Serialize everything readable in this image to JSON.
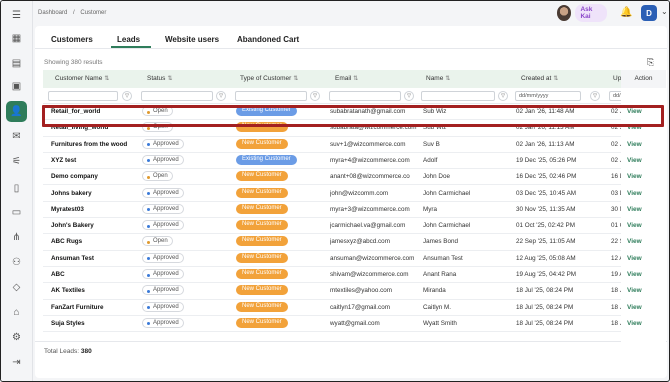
{
  "topbar": {
    "breadcrumb": [
      "Dashboard",
      "/",
      "Customer"
    ],
    "ask_kai_label": "Ask Kai",
    "user_initial": "D"
  },
  "tabs": [
    "Customers",
    "Leads",
    "Website users",
    "Abandoned Cart"
  ],
  "active_tab": "Leads",
  "showing_text": "Showing 380 results",
  "table": {
    "columns": [
      "Customer Name",
      "Status",
      "Type of Customer",
      "Email",
      "Name",
      "Created at",
      "Up"
    ],
    "date_placeholder": "dd/mm/yyyy",
    "date_placeholder_2": "dd/",
    "rows": [
      {
        "customer": "Retail_for_world",
        "status": "Open",
        "type": "Existing Customer",
        "email": "subabratanath@gmail.com",
        "name": "Sub Wiz",
        "created": "02 Jan '26, 11:48 AM",
        "up": "02 J"
      },
      {
        "customer": "Retail_living_world",
        "status": "Open",
        "type": "New Customer",
        "email": "subabrata@wizcommerce.com",
        "name": "Sub Wiz",
        "created": "02 Jan '26, 11:13 AM",
        "up": "02 J"
      },
      {
        "customer": "Furnitures from the wood",
        "status": "Approved",
        "type": "New Customer",
        "email": "suv+1@wizcommerce.com",
        "name": "Suv B",
        "created": "02 Jan '26, 11:13 AM",
        "up": "02 J"
      },
      {
        "customer": "XYZ test",
        "status": "Approved",
        "type": "Existing Customer",
        "email": "myra+4@wizcommerce.com",
        "name": "Adolf",
        "created": "19 Dec '25, 05:26 PM",
        "up": "02 J"
      },
      {
        "customer": "Demo company",
        "status": "Open",
        "type": "New Customer",
        "email": "anant+08@wizcommerce.co",
        "name": "John Doe",
        "created": "16 Dec '25, 02:46 PM",
        "up": "16 D"
      },
      {
        "customer": "Johns bakery",
        "status": "Approved",
        "type": "New Customer",
        "email": "john@wizcomm.com",
        "name": "John Carmichael",
        "created": "03 Dec '25, 10:45 AM",
        "up": "03 D"
      },
      {
        "customer": "Myratest03",
        "status": "Approved",
        "type": "New Customer",
        "email": "myra+3@wizcommerce.com",
        "name": "Myra",
        "created": "30 Nov '25, 11:35 AM",
        "up": "30 N"
      },
      {
        "customer": "John's Bakery",
        "status": "Approved",
        "type": "New Customer",
        "email": "jcarmichael.va@gmail.com",
        "name": "John Carmichael",
        "created": "01 Oct '25, 02:42 PM",
        "up": "01 O"
      },
      {
        "customer": "ABC Rugs",
        "status": "Open",
        "type": "New Customer",
        "email": "jamesxyz@abcd.com",
        "name": "James Bond",
        "created": "22 Sep '25, 11:05 AM",
        "up": "22 S"
      },
      {
        "customer": "Ansuman Test",
        "status": "Approved",
        "type": "New Customer",
        "email": "ansuman@wizcommerce.com",
        "name": "Ansuman Test",
        "created": "12 Aug '25, 05:08 AM",
        "up": "12 A"
      },
      {
        "customer": "ABC",
        "status": "Approved",
        "type": "New Customer",
        "email": "shivam@wizcommerce.com",
        "name": "Anant Rana",
        "created": "19 Aug '25, 04:42 PM",
        "up": "19 A"
      },
      {
        "customer": "AK Textiles",
        "status": "Approved",
        "type": "New Customer",
        "email": "mtextiles@yahoo.com",
        "name": "Miranda",
        "created": "18 Jul '25, 08:24 PM",
        "up": "18 J"
      },
      {
        "customer": "FanZart Furniture",
        "status": "Approved",
        "type": "New Customer",
        "email": "caitlyn17@gmail.com",
        "name": "Caitlyn M.",
        "created": "18 Jul '25, 08:24 PM",
        "up": "18 J"
      },
      {
        "customer": "Suja Styles",
        "status": "Approved",
        "type": "New Customer",
        "email": "wyatt@gmail.com",
        "name": "Wyatt Smith",
        "created": "18 Jul '25, 08:24 PM",
        "up": "18 J"
      }
    ]
  },
  "action": {
    "header": "Action",
    "view_label": "View"
  },
  "footer": {
    "total_label": "Total Leads:",
    "total_value": "380"
  },
  "colors": {
    "accent_green": "#2f7d5b",
    "existing_pill": "#6b9ce6",
    "new_pill": "#f2a23a",
    "highlight_border": "#a32020"
  }
}
